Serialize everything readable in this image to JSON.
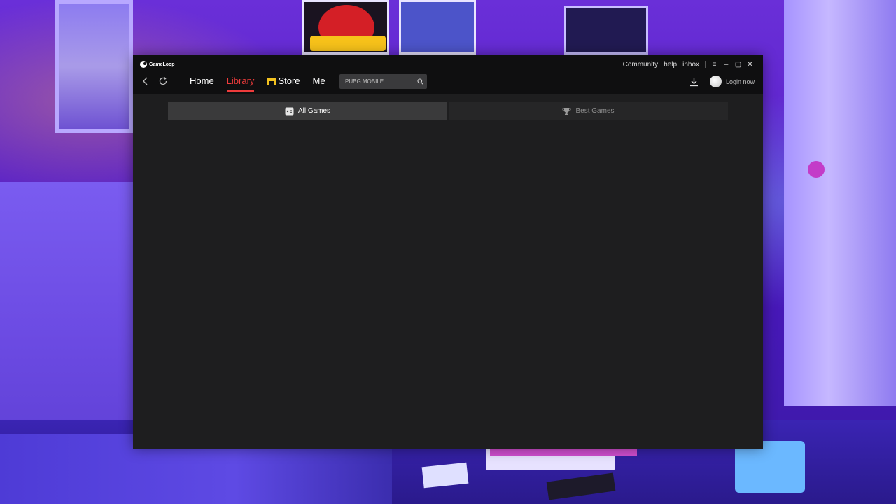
{
  "app": {
    "brand": "GameLoop",
    "accent_color": "#ee3b3b"
  },
  "titlebar": {
    "links": [
      "Community",
      "help",
      "inbox"
    ],
    "controls": {
      "menu": "≡",
      "minimize": "–",
      "maximize": "▢",
      "close": "✕"
    }
  },
  "nav": {
    "home": "Home",
    "library": "Library",
    "store": "Store",
    "me": "Me",
    "active": "Library"
  },
  "search": {
    "placeholder": "PUBG MOBILE"
  },
  "account": {
    "login_label": "Login now"
  },
  "tabs": {
    "all_games": "All Games",
    "best_games": "Best Games",
    "active": "All Games"
  }
}
